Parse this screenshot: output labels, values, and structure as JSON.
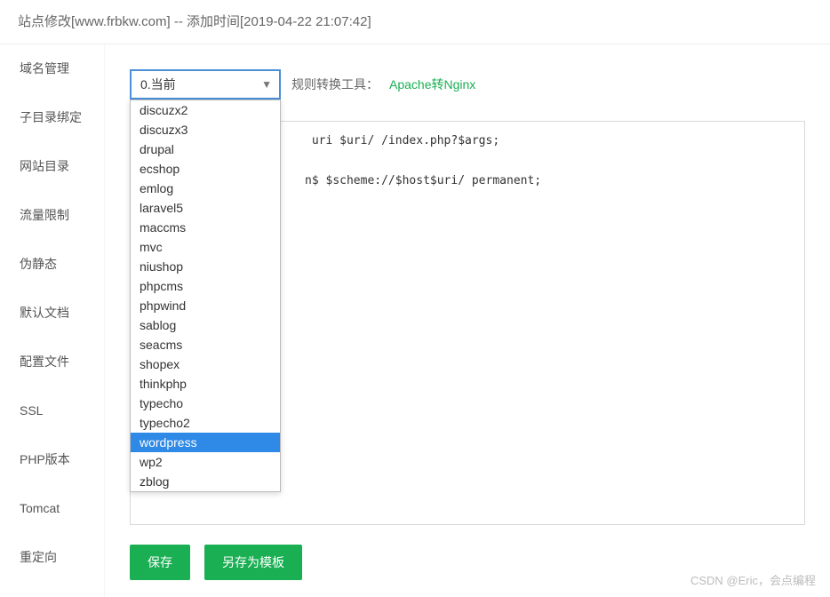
{
  "header": {
    "title": "站点修改[www.frbkw.com] -- 添加时间[2019-04-22 21:07:42]"
  },
  "sidebar": {
    "items": [
      {
        "label": "域名管理"
      },
      {
        "label": "子目录绑定"
      },
      {
        "label": "网站目录"
      },
      {
        "label": "流量限制"
      },
      {
        "label": "伪静态"
      },
      {
        "label": "默认文档"
      },
      {
        "label": "配置文件"
      },
      {
        "label": "SSL"
      },
      {
        "label": "PHP版本"
      },
      {
        "label": "Tomcat"
      },
      {
        "label": "重定向"
      }
    ],
    "active_index": 4
  },
  "select": {
    "value": "0.当前",
    "options": [
      "discuzx2",
      "discuzx3",
      "drupal",
      "ecshop",
      "emlog",
      "laravel5",
      "maccms",
      "mvc",
      "niushop",
      "phpcms",
      "phpwind",
      "sablog",
      "seacms",
      "shopex",
      "thinkphp",
      "typecho",
      "typecho2",
      "wordpress",
      "wp2",
      "zblog"
    ],
    "highlight": "wordpress"
  },
  "convert": {
    "label": "规则转换工具：",
    "link": "Apache转Nginx"
  },
  "editor": {
    "content": "                        uri $uri/ /index.php?$args;\n\n\n                       n$ $scheme://$host$uri/ permanent;"
  },
  "buttons": {
    "save": "保存",
    "save_as": "另存为模板"
  },
  "watermark": "CSDN @Eric，会点编程"
}
